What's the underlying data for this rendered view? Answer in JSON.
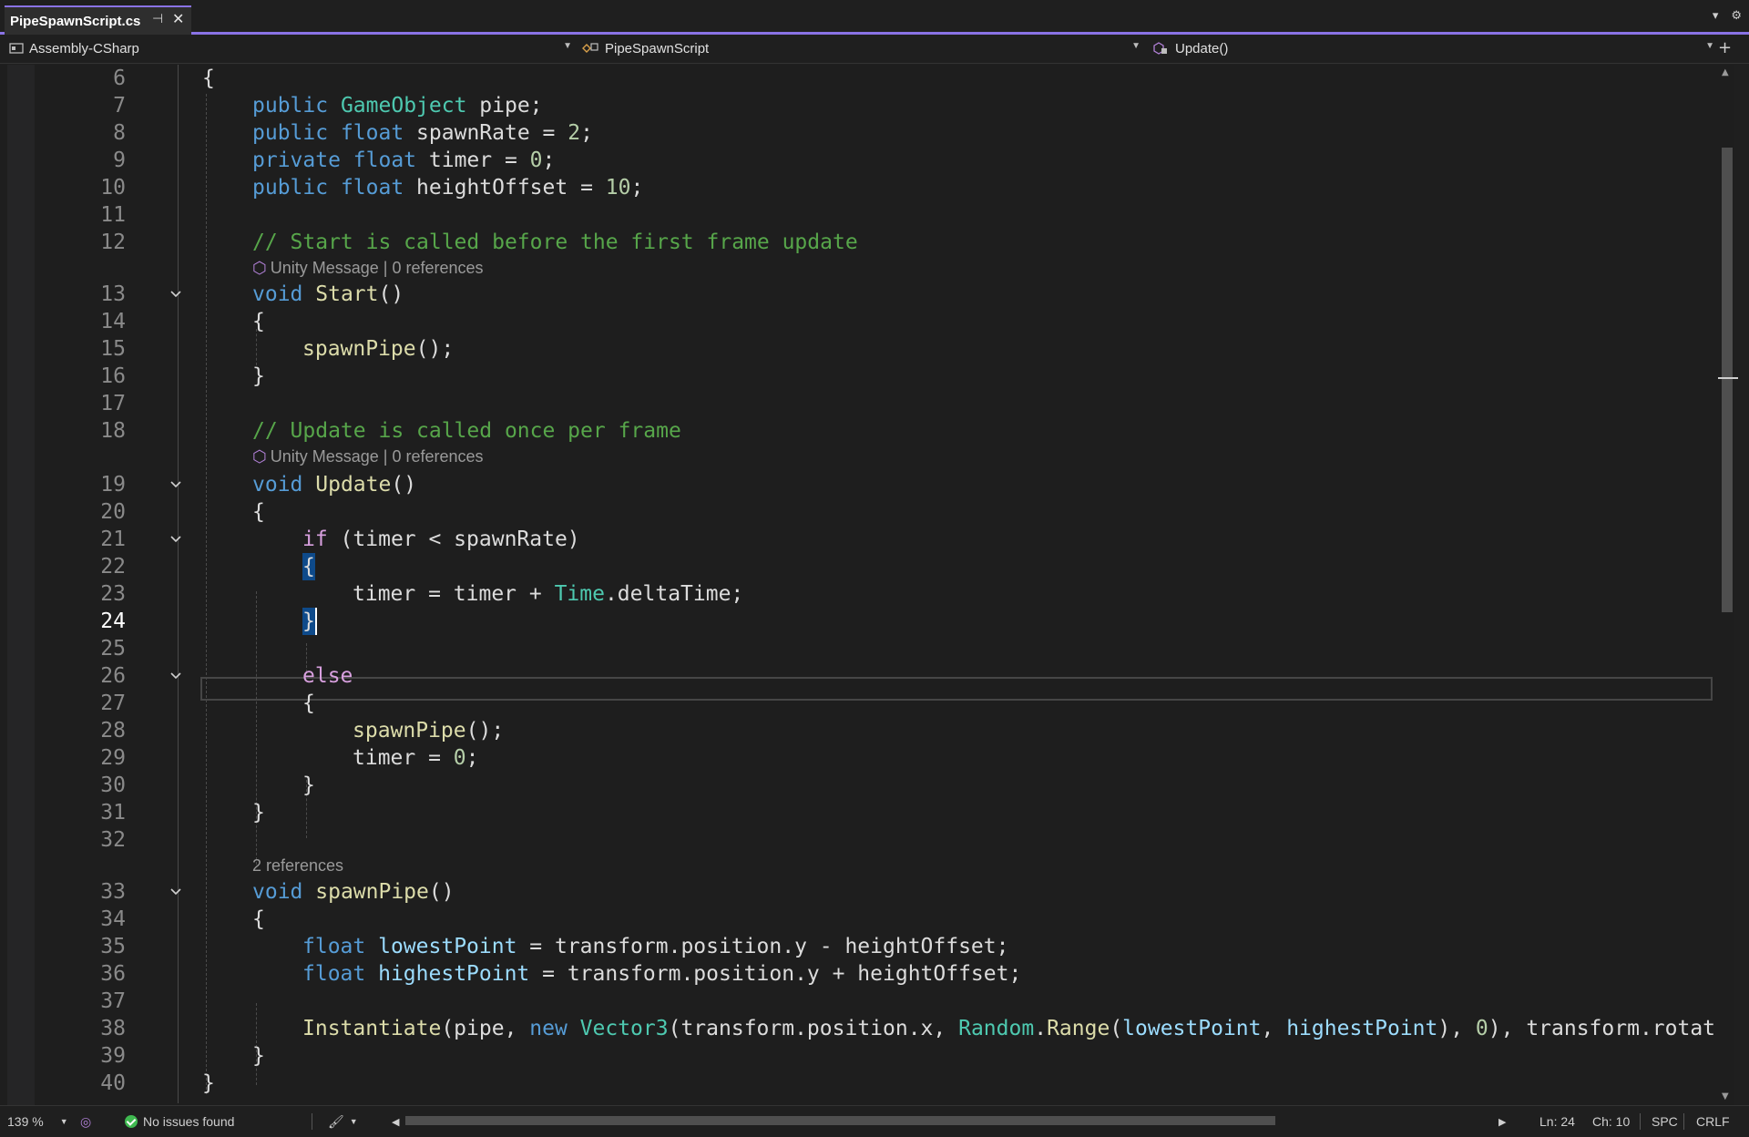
{
  "tab": {
    "title": "PipeSpawnScript.cs"
  },
  "navbar": {
    "project": "Assembly-CSharp",
    "class": "PipeSpawnScript",
    "member": "Update()"
  },
  "lens": {
    "start": {
      "kind": "Unity Message",
      "refs": "0 references"
    },
    "update": {
      "kind": "Unity Message",
      "refs": "0 references"
    },
    "spawn": {
      "refs": "2 references"
    }
  },
  "line_numbers": [
    "6",
    "7",
    "8",
    "9",
    "10",
    "11",
    "12",
    "13",
    "14",
    "15",
    "16",
    "17",
    "18",
    "19",
    "20",
    "21",
    "22",
    "23",
    "24",
    "25",
    "26",
    "27",
    "28",
    "29",
    "30",
    "31",
    "32",
    "33",
    "34",
    "35",
    "36",
    "37",
    "38",
    "39",
    "40"
  ],
  "code": {
    "l6": "{",
    "l7": [
      "public",
      " ",
      "GameObject",
      " pipe;"
    ],
    "l8": [
      "public",
      " ",
      "float",
      " spawnRate = ",
      "2",
      ";"
    ],
    "l9": [
      "private",
      " ",
      "float",
      " timer = ",
      "0",
      ";"
    ],
    "l10": [
      "public",
      " ",
      "float",
      " heightOffset = ",
      "10",
      ";"
    ],
    "l12": "// Start is called before the first frame update",
    "l13": [
      "void",
      " ",
      "Start",
      "()"
    ],
    "l14": "{",
    "l15": [
      "spawnPipe",
      "();"
    ],
    "l16": "}",
    "l18": "// Update is called once per frame",
    "l19": [
      "void",
      " ",
      "Update",
      "()"
    ],
    "l20": "{",
    "l21": [
      "if",
      " (timer < spawnRate)"
    ],
    "l22": "{",
    "l23": [
      "timer = timer + ",
      "Time",
      ".deltaTime;"
    ],
    "l24": "}",
    "l26": "else",
    "l27": "{",
    "l28": [
      "spawnPipe",
      "();"
    ],
    "l29": [
      "timer = ",
      "0",
      ";"
    ],
    "l30": "}",
    "l31": "}",
    "l33": [
      "void",
      " ",
      "spawnPipe",
      "()"
    ],
    "l34": "{",
    "l35": [
      "float",
      " ",
      "lowestPoint",
      " = transform.position.y - heightOffset;"
    ],
    "l36": [
      "float",
      " ",
      "highestPoint",
      " = transform.position.y + heightOffset;"
    ],
    "l38": [
      "Instantiate",
      "(pipe, ",
      "new",
      " ",
      "Vector3",
      "(transform.position.x, ",
      "Random",
      ".",
      "Range",
      "(",
      "lowestPoint",
      ", ",
      "highestPoint",
      "), ",
      "0",
      "), transform.rotatio"
    ],
    "l39": "}",
    "l40": "}"
  },
  "status": {
    "zoom": "139 %",
    "issues": "No issues found",
    "line": "Ln: 24",
    "char": "Ch: 10",
    "whitespace": "SPC",
    "line_ending": "CRLF"
  },
  "colors": {
    "accent": "#8a73e6",
    "keyword": "#569cd6",
    "control": "#d8a0df",
    "type": "#4ec9b0",
    "method": "#dcdcaa",
    "number": "#b5cea8",
    "comment": "#57a64a",
    "local": "#9cdcfe",
    "ok": "#3fb950"
  },
  "icons": [
    "pin-icon",
    "close-icon",
    "chevron-down-icon",
    "gear-icon",
    "project-icon",
    "class-icon",
    "method-icon",
    "unity-message-icon",
    "fold-chevron-icon",
    "check-circle-icon",
    "brush-icon",
    "arrow-left-icon",
    "arrow-right-icon",
    "arrow-up-icon",
    "arrow-down-icon",
    "split-icon"
  ]
}
